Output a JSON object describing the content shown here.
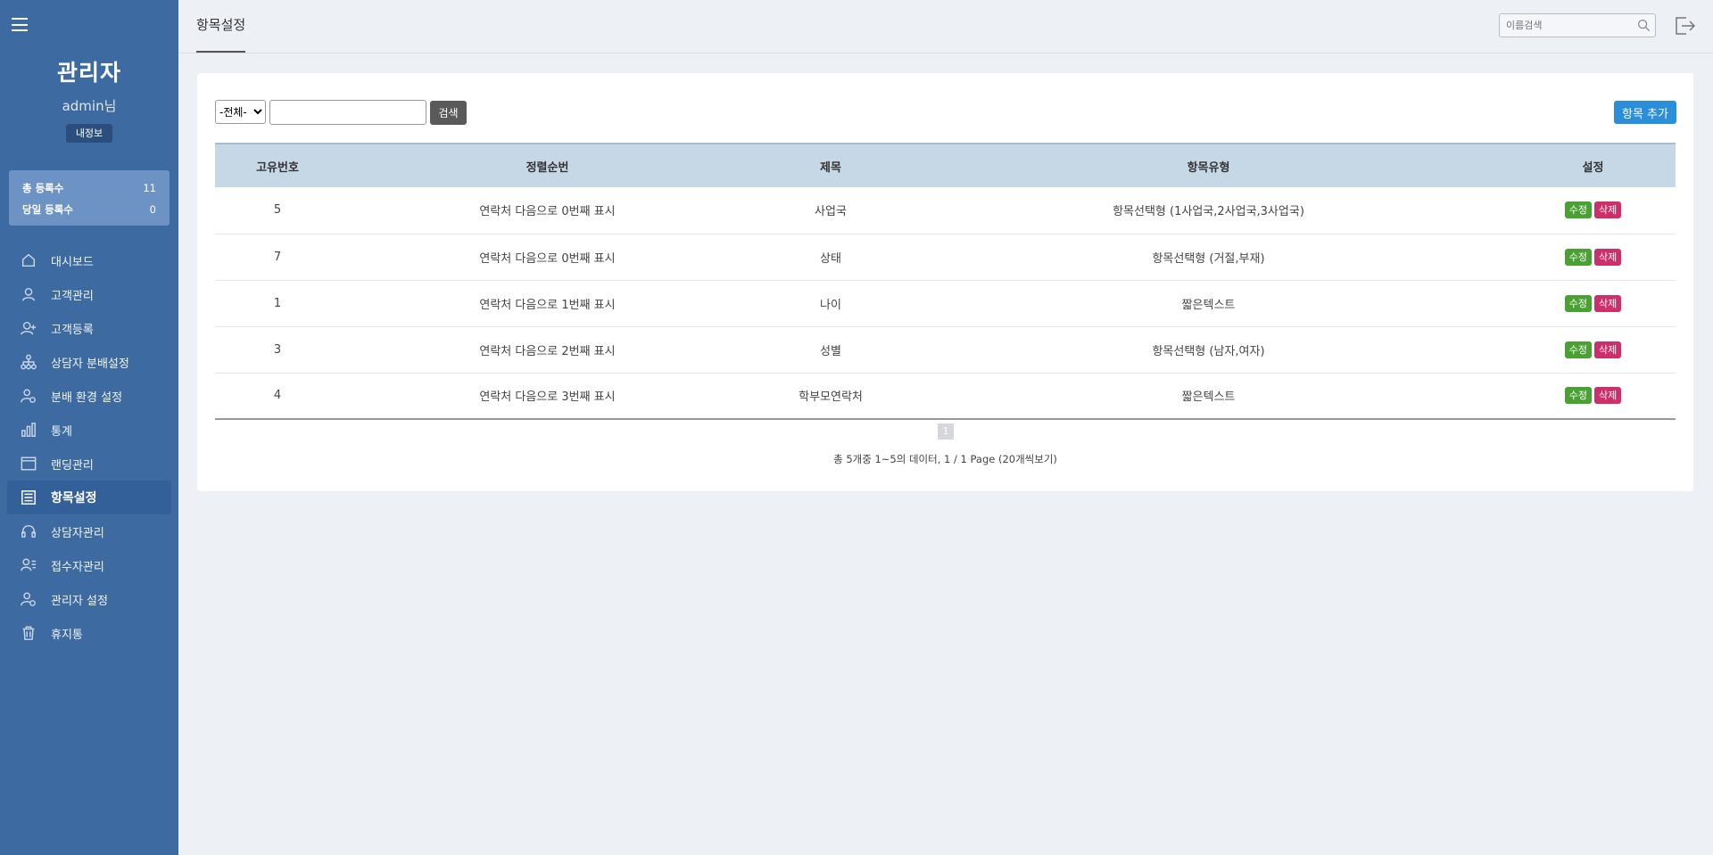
{
  "sidebar": {
    "brand": "관리자",
    "user": "admin님",
    "profile_button": "내정보",
    "stats": [
      {
        "label": "총 등록수",
        "value": "11"
      },
      {
        "label": "당일 등록수",
        "value": "0"
      }
    ],
    "menu": [
      {
        "label": "대시보드",
        "icon": "home-icon"
      },
      {
        "label": "고객관리",
        "icon": "user-icon"
      },
      {
        "label": "고객등록",
        "icon": "user-add-icon"
      },
      {
        "label": "상담자 분배설정",
        "icon": "hierarchy-icon"
      },
      {
        "label": "분배 환경 설정",
        "icon": "user-gear-icon"
      },
      {
        "label": "통계",
        "icon": "bar-chart-icon"
      },
      {
        "label": "랜딩관리",
        "icon": "browser-icon"
      },
      {
        "label": "항목설정",
        "icon": "list-icon",
        "active": true
      },
      {
        "label": "상담자관리",
        "icon": "headset-icon"
      },
      {
        "label": "접수자관리",
        "icon": "user-list-icon"
      },
      {
        "label": "관리자 설정",
        "icon": "user-gear-icon"
      },
      {
        "label": "휴지통",
        "icon": "trash-icon"
      }
    ]
  },
  "header": {
    "title": "항목설정",
    "search_placeholder": "이름검색"
  },
  "toolbar": {
    "filter_selected": "-전체-",
    "search_button": "검색",
    "add_button": "항목 추가"
  },
  "table": {
    "columns": [
      "고유번호",
      "정렬순번",
      "제목",
      "항목유형",
      "설정"
    ],
    "rows": [
      {
        "id": "5",
        "order": "연락처 다음으로 0번째 표시",
        "title": "사업국",
        "type": "항목선택형 (1사업국,2사업국,3사업국)"
      },
      {
        "id": "7",
        "order": "연락처 다음으로 0번째 표시",
        "title": "상태",
        "type": "항목선택형 (거절,부재)"
      },
      {
        "id": "1",
        "order": "연락처 다음으로 1번째 표시",
        "title": "나이",
        "type": "짧은텍스트"
      },
      {
        "id": "3",
        "order": "연락처 다음으로 2번째 표시",
        "title": "성별",
        "type": "항목선택형 (남자,여자)"
      },
      {
        "id": "4",
        "order": "연락처 다음으로 3번째 표시",
        "title": "학부모연락처",
        "type": "짧은텍스트"
      }
    ],
    "edit_label": "수정",
    "delete_label": "삭제"
  },
  "pagination": {
    "current_page": "1",
    "info": "총 5개중 1~5의 데이터, 1 / 1 Page (20개씩보기)"
  }
}
